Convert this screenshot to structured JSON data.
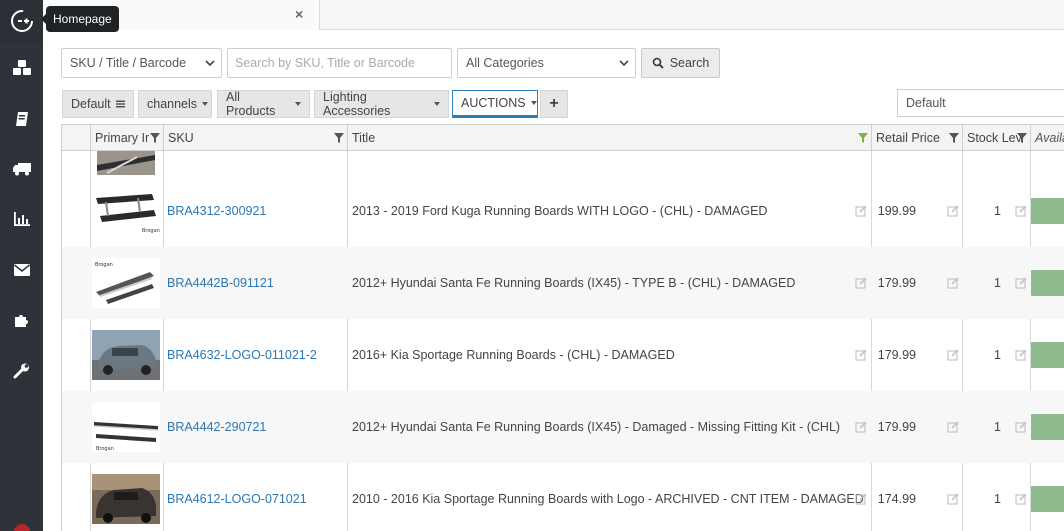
{
  "tooltip": {
    "text": "Homepage"
  },
  "tab": {
    "label": "y",
    "close": "×"
  },
  "filters": {
    "search_by": "SKU / Title / Barcode",
    "search_placeholder": "Search by SKU, Title or Barcode",
    "category": "All Categories",
    "search_button": "Search"
  },
  "views": {
    "chips": [
      "Default",
      "channels",
      "All Products",
      "Lighting Accessories",
      "AUCTIONS"
    ],
    "add": "+",
    "selected_view": "Default"
  },
  "columns": [
    "Primary Ir",
    "SKU",
    "Title",
    "Retail Price",
    "Stock Lev",
    "Availa"
  ],
  "rows": [
    {
      "sku": "BRA4312-300921",
      "title": "2013 - 2019 Ford Kuga Running Boards WITH LOGO - (CHL) - DAMAGED",
      "price": "199.99",
      "stock": "1"
    },
    {
      "sku": "BRA4442B-091121",
      "title": "2012+ Hyundai Santa Fe Running Boards (IX45) - TYPE B - (CHL) - DAMAGED",
      "price": "179.99",
      "stock": "1"
    },
    {
      "sku": "BRA4632-LOGO-011021-2",
      "title": "2016+ Kia Sportage Running Boards - (CHL) - DAMAGED",
      "price": "179.99",
      "stock": "1"
    },
    {
      "sku": "BRA4442-290721",
      "title": "2012+ Hyundai Santa Fe Running Boards (IX45) - Damaged - Missing Fitting Kit - (CHL)",
      "price": "179.99",
      "stock": "1"
    },
    {
      "sku": "BRA4612-LOGO-071021",
      "title": "2010 - 2016 Kia Sportage Running Boards with Logo - ARCHIVED - CNT ITEM - DAMAGED",
      "price": "174.99",
      "stock": "1"
    }
  ],
  "colors": {
    "sidebar": "#2d3339",
    "link": "#2b78b4",
    "active_tab": "#2e7fb5",
    "availability": "#8fbc8f"
  }
}
